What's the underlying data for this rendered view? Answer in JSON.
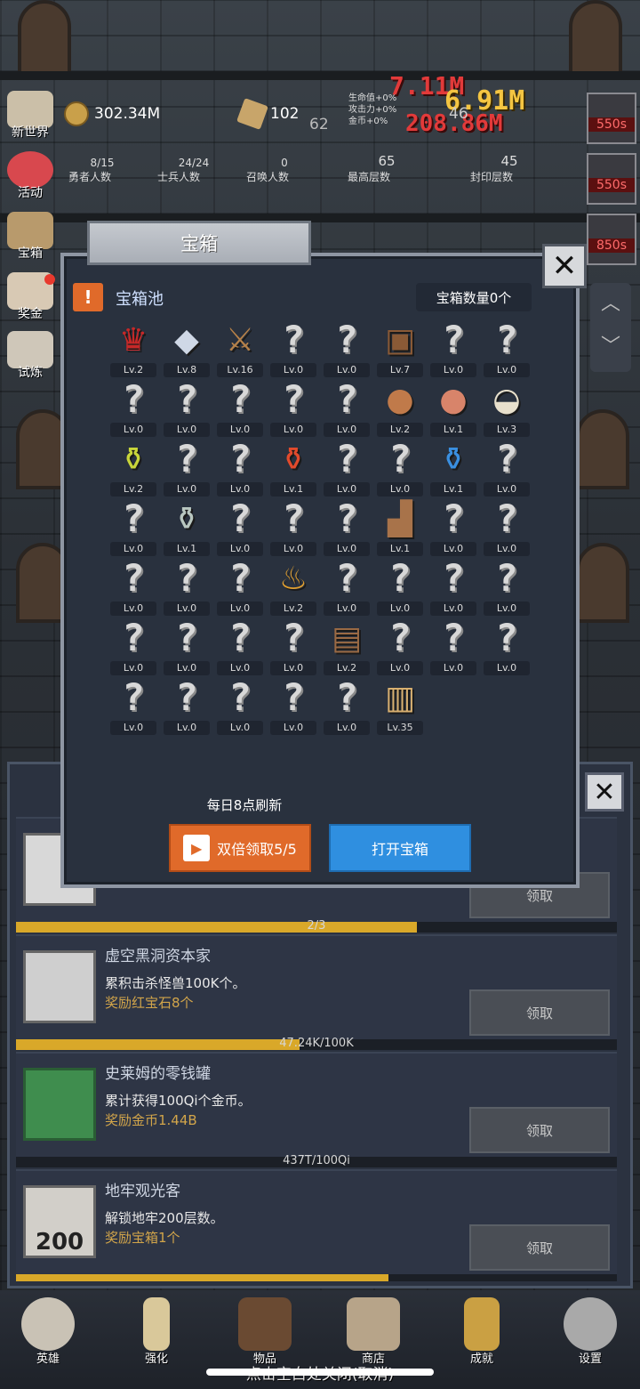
{
  "hud": {
    "gold": "302.34M",
    "gems": "102",
    "level_num": "62",
    "bonus_lines": [
      "生命值+0%",
      "攻击力+0%",
      "金币+0%"
    ],
    "floor_right": "46",
    "heroes": {
      "value": "8/15",
      "label": "勇者人数"
    },
    "soldiers": {
      "value": "24/24",
      "label": "士兵人数"
    },
    "summons": {
      "value": "0",
      "label": "召唤人数"
    },
    "max_floor": {
      "value": "65",
      "label": "最高层数"
    },
    "sealed_floor": {
      "value": "45",
      "label": "封印层数"
    },
    "damage_a": "7.11M",
    "damage_b": "6.91M",
    "damage_c": "208.86M"
  },
  "side_menu": [
    "新世界",
    "活动",
    "宝箱",
    "奖金",
    "试炼"
  ],
  "right_badges": [
    "550s",
    "550s",
    "850s"
  ],
  "modal": {
    "tab_title": "宝箱",
    "close_label": "✕",
    "pool_warn": "!",
    "pool_title": "宝箱池",
    "chest_count": "宝箱数量0个",
    "refresh_note": "每日8点刷新",
    "double_button": "双倍领取5/5",
    "open_button": "打开宝箱",
    "items": [
      {
        "icon": "crown-icon",
        "lv": "Lv.2"
      },
      {
        "icon": "diamond-icon",
        "lv": "Lv.8"
      },
      {
        "icon": "sword-icon",
        "lv": "Lv.16"
      },
      {
        "icon": "unknown-icon",
        "lv": "Lv.0"
      },
      {
        "icon": "unknown-icon",
        "lv": "Lv.0"
      },
      {
        "icon": "armor-icon",
        "lv": "Lv.7"
      },
      {
        "icon": "unknown-icon",
        "lv": "Lv.0"
      },
      {
        "icon": "unknown-icon",
        "lv": "Lv.0"
      },
      {
        "icon": "unknown-icon",
        "lv": "Lv.0"
      },
      {
        "icon": "unknown-icon",
        "lv": "Lv.0"
      },
      {
        "icon": "unknown-icon",
        "lv": "Lv.0"
      },
      {
        "icon": "unknown-icon",
        "lv": "Lv.0"
      },
      {
        "icon": "unknown-icon",
        "lv": "Lv.0"
      },
      {
        "icon": "ham-icon",
        "lv": "Lv.2"
      },
      {
        "icon": "steak-icon",
        "lv": "Lv.1"
      },
      {
        "icon": "rice-icon",
        "lv": "Lv.3"
      },
      {
        "icon": "yellow-potion-icon",
        "lv": "Lv.2"
      },
      {
        "icon": "unknown-icon",
        "lv": "Lv.0"
      },
      {
        "icon": "unknown-icon",
        "lv": "Lv.0"
      },
      {
        "icon": "red-potion-icon",
        "lv": "Lv.1"
      },
      {
        "icon": "unknown-icon",
        "lv": "Lv.0"
      },
      {
        "icon": "unknown-icon",
        "lv": "Lv.0"
      },
      {
        "icon": "blue-potion-icon",
        "lv": "Lv.1"
      },
      {
        "icon": "unknown-icon",
        "lv": "Lv.0"
      },
      {
        "icon": "unknown-icon",
        "lv": "Lv.0"
      },
      {
        "icon": "empty-bottle-icon",
        "lv": "Lv.1"
      },
      {
        "icon": "unknown-icon",
        "lv": "Lv.0"
      },
      {
        "icon": "unknown-icon",
        "lv": "Lv.0"
      },
      {
        "icon": "unknown-icon",
        "lv": "Lv.0"
      },
      {
        "icon": "boot-icon",
        "lv": "Lv.1"
      },
      {
        "icon": "unknown-icon",
        "lv": "Lv.0"
      },
      {
        "icon": "unknown-icon",
        "lv": "Lv.0"
      },
      {
        "icon": "unknown-icon",
        "lv": "Lv.0"
      },
      {
        "icon": "unknown-icon",
        "lv": "Lv.0"
      },
      {
        "icon": "unknown-icon",
        "lv": "Lv.0"
      },
      {
        "icon": "torch-icon",
        "lv": "Lv.2"
      },
      {
        "icon": "unknown-icon",
        "lv": "Lv.0"
      },
      {
        "icon": "unknown-icon",
        "lv": "Lv.0"
      },
      {
        "icon": "unknown-icon",
        "lv": "Lv.0"
      },
      {
        "icon": "unknown-icon",
        "lv": "Lv.0"
      },
      {
        "icon": "unknown-icon",
        "lv": "Lv.0"
      },
      {
        "icon": "unknown-icon",
        "lv": "Lv.0"
      },
      {
        "icon": "unknown-icon",
        "lv": "Lv.0"
      },
      {
        "icon": "unknown-icon",
        "lv": "Lv.0"
      },
      {
        "icon": "backpack-icon",
        "lv": "Lv.2"
      },
      {
        "icon": "unknown-icon",
        "lv": "Lv.0"
      },
      {
        "icon": "unknown-icon",
        "lv": "Lv.0"
      },
      {
        "icon": "unknown-icon",
        "lv": "Lv.0"
      },
      {
        "icon": "unknown-icon",
        "lv": "Lv.0"
      },
      {
        "icon": "unknown-icon",
        "lv": "Lv.0"
      },
      {
        "icon": "unknown-icon",
        "lv": "Lv.0"
      },
      {
        "icon": "unknown-icon",
        "lv": "Lv.0"
      },
      {
        "icon": "unknown-icon",
        "lv": "Lv.0"
      },
      {
        "icon": "beer-mug-icon",
        "lv": "Lv.35"
      }
    ]
  },
  "achievements": {
    "close_label": "✕",
    "rows": [
      {
        "title": "",
        "desc": "",
        "reward": "",
        "claim": "领取",
        "progress_text": "2/3",
        "progress": 0.667
      },
      {
        "title": "虚空黑洞资本家",
        "desc": "累积击杀怪兽100K个。",
        "reward": "奖励红宝石8个",
        "claim": "领取",
        "progress_text": "47.24K/100K",
        "progress": 0.4724
      },
      {
        "title": "史莱姆的零钱罐",
        "desc": "累计获得100Qi个金币。",
        "reward": "奖励金币1.44B",
        "claim": "领取",
        "progress_text": "437T/100Qi",
        "progress": 0.0
      },
      {
        "title": "地牢观光客",
        "desc": "解锁地牢200层数。",
        "reward": "奖励宝箱1个",
        "claim": "领取",
        "thumb_text": "200",
        "progress": 0.62
      }
    ]
  },
  "nav": [
    "英雄",
    "强化",
    "物品",
    "商店",
    "成就",
    "设置"
  ],
  "close_hint": "点击空白处关闭(取消)",
  "colors": {
    "accent_orange": "#e06a2a",
    "accent_blue": "#2f8fe0",
    "gold_text": "#d2a54a",
    "progress_gold": "#d9a829"
  }
}
